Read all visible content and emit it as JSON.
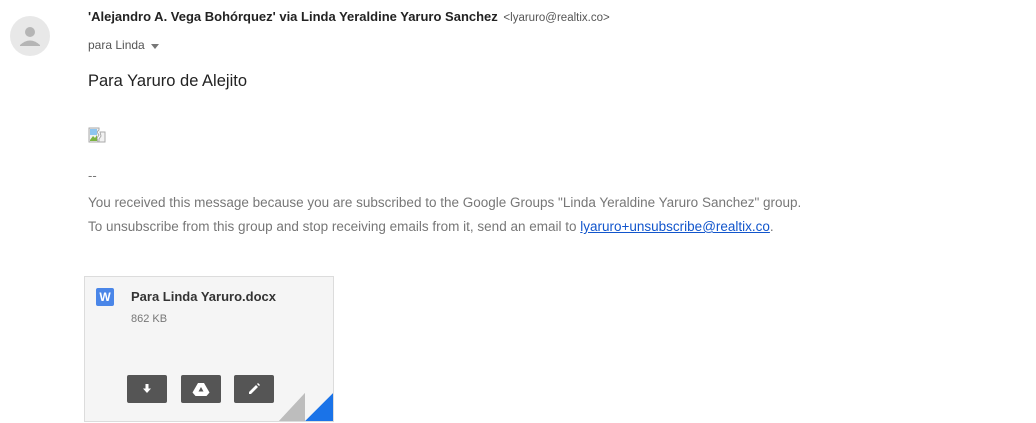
{
  "sender": {
    "name": "'Alejandro A. Vega Bohórquez' via Linda Yeraldine Yaruro Sanchez",
    "email": "<lyaruro@realtix.co>"
  },
  "recipient": {
    "label": "para Linda"
  },
  "body": {
    "greeting": "Para Yaruro de Alejito",
    "signature_dash": "--",
    "footer_line1": "You received this message because you are subscribed to the Google Groups \"Linda Yeraldine Yaruro Sanchez\" group.",
    "footer_line2_prefix": "To unsubscribe from this group and stop receiving emails from it, send an email to ",
    "unsubscribe_link": "lyaruro+unsubscribe@realtix.co",
    "footer_line2_suffix": "."
  },
  "attachment": {
    "type_letter": "W",
    "filename": "Para Linda Yaruro.docx",
    "size": "862 KB",
    "actions": [
      "download-icon",
      "drive-icon",
      "edit-icon"
    ]
  },
  "colors": {
    "link": "#1155cc",
    "word_icon": "#4a86e8",
    "corner_fold": "#1a73e8",
    "button": "#555555"
  }
}
